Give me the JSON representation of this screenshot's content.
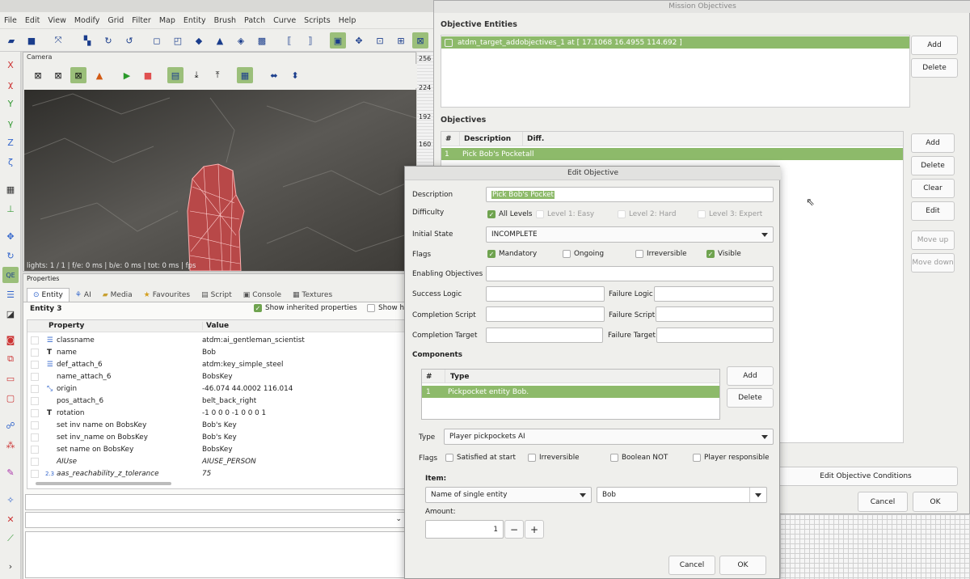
{
  "menu": [
    "File",
    "Edit",
    "View",
    "Modify",
    "Grid",
    "Filter",
    "Map",
    "Entity",
    "Brush",
    "Patch",
    "Curve",
    "Scripts",
    "Help"
  ],
  "camera": {
    "title": "Camera",
    "status": "lights: 1 / 1 | f/e: 0 ms | b/e: 0 ms | tot: 0 ms | fps"
  },
  "properties": {
    "title": "Properties",
    "tabs": [
      "Entity",
      "AI",
      "Media",
      "Favourites",
      "Script",
      "Console",
      "Textures"
    ],
    "entity_label": "Entity 3",
    "show_inherited": "Show inherited properties",
    "show_help": "Show he",
    "col_property": "Property",
    "col_value": "Value",
    "rows": [
      {
        "name": "classname",
        "value": "atdm:ai_gentleman_scientist"
      },
      {
        "name": "name",
        "value": "Bob"
      },
      {
        "name": "def_attach_6",
        "value": "atdm:key_simple_steel"
      },
      {
        "name": "name_attach_6",
        "value": "BobsKey"
      },
      {
        "name": "origin",
        "value": "-46.074 44.0002 116.014"
      },
      {
        "name": "pos_attach_6",
        "value": "belt_back_right"
      },
      {
        "name": "rotation",
        "value": "-1 0 0 0 -1 0 0 0 1"
      },
      {
        "name": "set inv name on BobsKey",
        "value": "Bob's Key"
      },
      {
        "name": "set inv_name on BobsKey",
        "value": "Bob's Key"
      },
      {
        "name": "set name on BobsKey",
        "value": "BobsKey"
      },
      {
        "name": "AIUse",
        "value": "AIUSE_PERSON"
      },
      {
        "name": "aas_reachability_z_tolerance",
        "value": "75"
      }
    ],
    "row_badge": "2.3"
  },
  "ruler": [
    "256",
    "224",
    "192",
    "160"
  ],
  "mission": {
    "title": "Mission Objectives",
    "entities_label": "Objective Entities",
    "entity_item": "atdm_target_addobjectives_1 at [ 17.1068 16.4955 114.692 ]",
    "entities_add": "Add",
    "entities_delete": "Delete",
    "objectives_label": "Objectives",
    "col_num": "#",
    "col_desc": "Description",
    "col_diff": "Diff.",
    "objective_row": {
      "num": "1",
      "desc": "Pick Bob's Pocket",
      "diff": "all"
    },
    "buttons": [
      "Add",
      "Delete",
      "Clear",
      "Edit"
    ],
    "move_up": "Move up",
    "move_down": "Move down",
    "edit_conditions": "Edit Objective Conditions",
    "cancel": "Cancel",
    "ok": "OK"
  },
  "edit_objective": {
    "title": "Edit Objective",
    "description_label": "Description",
    "description_value": "Pick Bob's Pocket",
    "difficulty_label": "Difficulty",
    "difficulty": [
      "All Levels",
      "Level 1: Easy",
      "Level 2: Hard",
      "Level 3: Expert"
    ],
    "initial_state_label": "Initial State",
    "initial_state_value": "INCOMPLETE",
    "flags_label": "Flags",
    "flags": [
      "Mandatory",
      "Ongoing",
      "Irreversible",
      "Visible"
    ],
    "enabling_label": "Enabling Objectives",
    "success_logic_label": "Success Logic",
    "failure_logic_label": "Failure Logic",
    "completion_script_label": "Completion Script",
    "failure_script_label": "Failure Script",
    "completion_target_label": "Completion Target",
    "failure_target_label": "Failure Target",
    "components_label": "Components",
    "comp_col_num": "#",
    "comp_col_type": "Type",
    "component_row": {
      "num": "1",
      "type": "Pickpocket entity Bob."
    },
    "comp_add": "Add",
    "comp_delete": "Delete",
    "type_label": "Type",
    "type_value": "Player pickpockets AI",
    "comp_flags_label": "Flags",
    "comp_flags": [
      "Satisfied at start",
      "Irreversible",
      "Boolean NOT",
      "Player responsible"
    ],
    "item_label": "Item:",
    "item_kind": "Name of single entity",
    "item_value": "Bob",
    "amount_label": "Amount:",
    "amount_value": "1",
    "minus": "−",
    "plus": "+",
    "cancel": "Cancel",
    "ok": "OK"
  },
  "colors": {
    "selection": "#8dba6a",
    "checked": "#6fa34f",
    "toolbar_active": "#9bbf7a"
  }
}
